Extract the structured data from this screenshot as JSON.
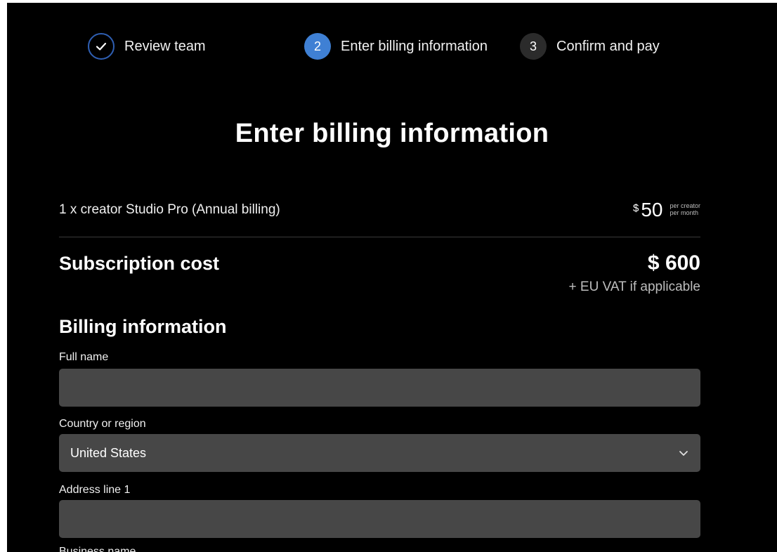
{
  "stepper": {
    "steps": [
      {
        "number": "✓",
        "label": "Review team",
        "state": "completed"
      },
      {
        "number": "2",
        "label": "Enter billing information",
        "state": "active"
      },
      {
        "number": "3",
        "label": "Confirm and pay",
        "state": "upcoming"
      }
    ]
  },
  "page": {
    "title": "Enter billing information"
  },
  "order": {
    "item_label": "1 x creator Studio Pro (Annual billing)",
    "price_currency": "$",
    "price_amount": "50",
    "price_unit_line1": "per creator",
    "price_unit_line2": "per month"
  },
  "subscription": {
    "label": "Subscription cost",
    "amount": "$ 600",
    "vat_note": "+ EU VAT if applicable"
  },
  "billing": {
    "title": "Billing information",
    "full_name_label": "Full name",
    "full_name_value": "",
    "country_label": "Country or region",
    "country_value": "United States",
    "address1_label": "Address line 1",
    "address1_value": "",
    "business_label": "Business name"
  },
  "colors": {
    "background": "#000000",
    "active_step": "#3f80d4",
    "completed_ring": "#2f5fb3",
    "input_bg": "#474747"
  }
}
